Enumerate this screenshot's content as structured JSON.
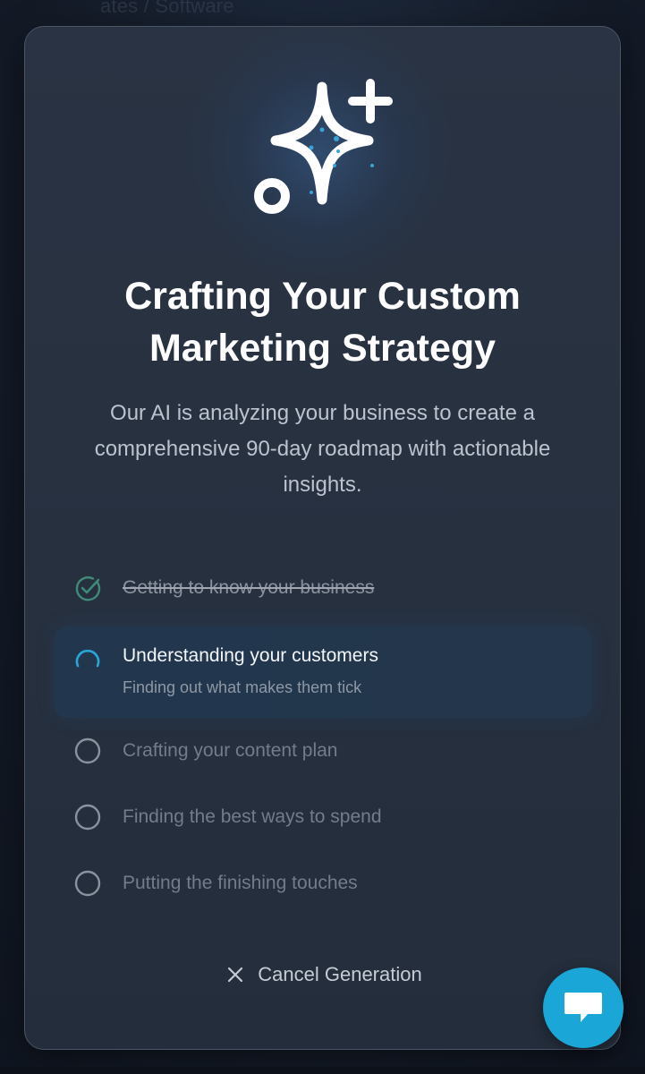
{
  "background": {
    "header_text": "ates / Software"
  },
  "modal": {
    "title_line1": "Crafting Your Custom",
    "title_line2": "Marketing Strategy",
    "subtitle": "Our AI is analyzing your business to create a comprehensive 90-day roadmap with actionable insights.",
    "steps": [
      {
        "label": "Getting to know your business",
        "status": "done"
      },
      {
        "label": "Understanding your customers",
        "sublabel": "Finding out what makes them tick",
        "status": "active"
      },
      {
        "label": "Crafting your content plan",
        "status": "pending"
      },
      {
        "label": "Finding the best ways to spend",
        "status": "pending"
      },
      {
        "label": "Putting the finishing touches",
        "status": "pending"
      }
    ],
    "cancel_label": "Cancel Generation"
  },
  "icons": {
    "hero": "sparkle-icon",
    "done": "check-circle-icon",
    "active": "spinner-icon",
    "pending": "empty-circle-icon",
    "cancel": "close-icon",
    "chat": "chat-icon"
  },
  "colors": {
    "background": "#141b28",
    "modal": "#273140",
    "accent": "#1aa6d6",
    "done": "#3f8a79",
    "title": "#ffffff"
  }
}
